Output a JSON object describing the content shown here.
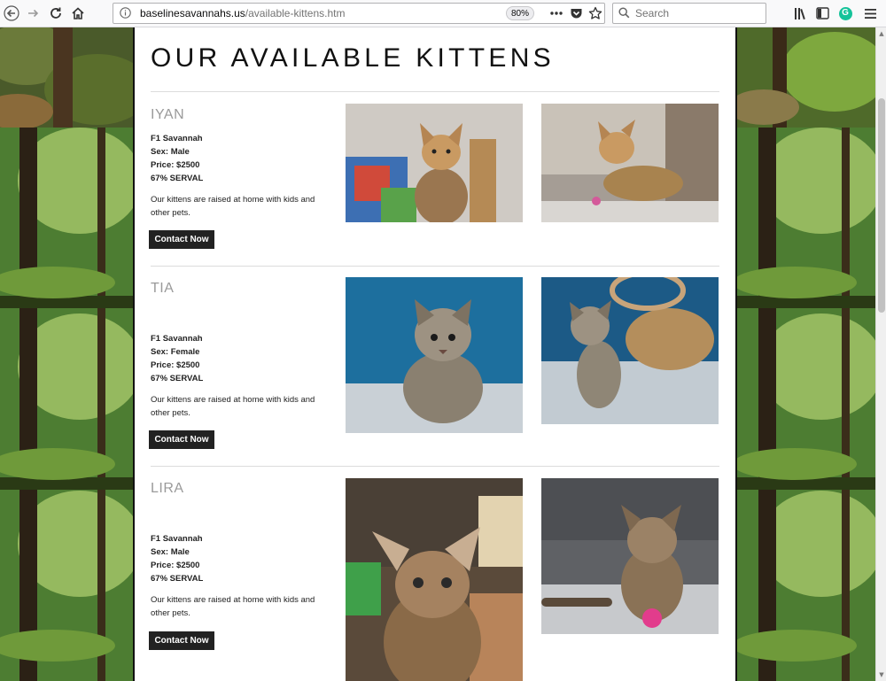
{
  "browser": {
    "url_host": "baselinesavannahs.us",
    "url_path": "/available-kittens.htm",
    "zoom": "80%",
    "search_placeholder": "Search",
    "grammarly_letter": "G",
    "icons": [
      "back-icon",
      "forward-icon",
      "reload-icon",
      "home-icon",
      "info-icon",
      "page-actions-icon",
      "pocket-icon",
      "bookmark-star-icon",
      "search-icon",
      "library-icon",
      "sidebar-icon",
      "grammarly-icon",
      "menu-icon"
    ]
  },
  "page": {
    "title": "OUR AVAILABLE KITTENS",
    "kittens": [
      {
        "name": "IYAN",
        "generation": "F1 Savannah",
        "sex": "Sex: Male",
        "price": "Price: $2500",
        "serval": "67% SERVAL",
        "description": "Our kittens are raised at home with kids and other pets.",
        "button": "Contact Now"
      },
      {
        "name": "TIA",
        "generation": "F1 Savannah",
        "sex": "Sex: Female",
        "price": "Price: $2500",
        "serval": "67% SERVAL",
        "description": "Our kittens are raised at home with kids and other pets.",
        "button": "Contact Now"
      },
      {
        "name": "LIRA",
        "generation": "F1 Savannah",
        "sex": "Sex: Male",
        "price": "Price: $2500",
        "serval": "67% SERVAL",
        "description": "Our kittens are raised at home with kids and other pets.",
        "button": "Contact Now"
      }
    ]
  },
  "colors": {
    "content_bg": "#ffffff",
    "button_bg": "#222222",
    "name_gray": "#9a9a9a",
    "forest_green": "#3f6b2a"
  }
}
